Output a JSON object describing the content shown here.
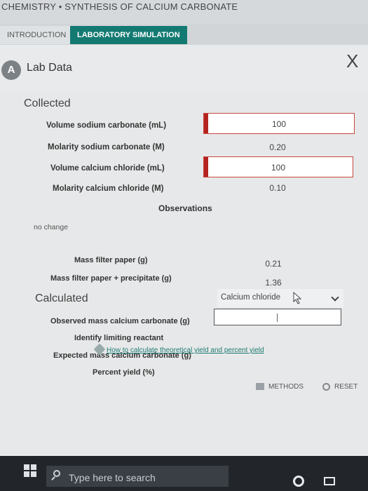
{
  "window": {
    "title": "CHEMISTRY • SYNTHESIS OF CALCIUM CARBONATE"
  },
  "tabs": [
    {
      "label": "INTRODUCTION",
      "active": false
    },
    {
      "label": "LABORATORY SIMULATION",
      "active": true
    }
  ],
  "panel": {
    "badge": "A",
    "title": "Lab Data",
    "close": "X"
  },
  "collected": {
    "heading": "Collected",
    "rows": [
      {
        "label": "Volume sodium carbonate (mL)",
        "value": "100",
        "editable": true
      },
      {
        "label": "Molarity sodium carbonate (M)",
        "value": "0.20",
        "editable": false
      },
      {
        "label": "Volume calcium chloride (mL)",
        "value": "100",
        "editable": true
      },
      {
        "label": "Molarity calcium chloride (M)",
        "value": "0.10",
        "editable": false
      }
    ],
    "observations_label": "Observations",
    "observations_text": "no change",
    "mass_rows": [
      {
        "label": "Mass filter paper (g)",
        "value": "0.21"
      },
      {
        "label": "Mass filter paper + precipitate (g)",
        "value": "1.36"
      }
    ]
  },
  "calculated": {
    "heading": "Calculated",
    "rows": [
      {
        "label": "Observed mass calcium carbonate (g)"
      },
      {
        "label": "Identify limiting reactant"
      },
      {
        "label": "Expected mass calcium carbonate (g)"
      },
      {
        "label": "Percent yield (%)"
      }
    ],
    "limiting_reactant_selected": "Calcium chloride",
    "help_link": "How to calculate theoretical yield and percent yield"
  },
  "footer": {
    "methods": "METHODS",
    "reset": "RESET"
  },
  "taskbar": {
    "search_placeholder": "Type here to search"
  },
  "colors": {
    "accent": "#137a72",
    "error_border": "#c8473f"
  }
}
